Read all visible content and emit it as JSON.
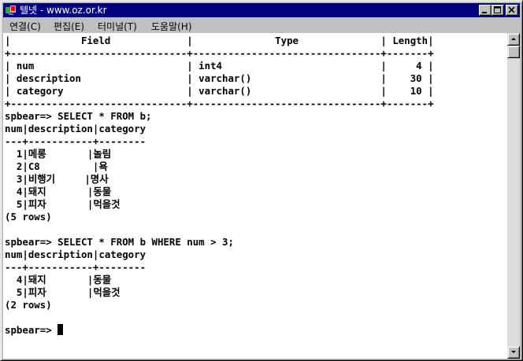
{
  "window": {
    "title": "텔넷 - www.oz.or.kr",
    "icon": "telnet-app-icon",
    "minimize_icon": "minimize-icon",
    "maximize_icon": "maximize-icon",
    "close_icon": "close-icon"
  },
  "menu": {
    "items": [
      {
        "label": "연결(C)"
      },
      {
        "label": "편집(E)"
      },
      {
        "label": "터미널(T)"
      },
      {
        "label": "도움말(H)"
      }
    ]
  },
  "terminal": {
    "lines": [
      "|            Field             |              Type              | Length|",
      "+------------------------------+--------------------------------+-------+",
      "| num                          | int4                           |     4 |",
      "| description                  | varchar()                      |    30 |",
      "| category                     | varchar()                      |    10 |",
      "+------------------------------+--------------------------------+-------+",
      "spbear=> SELECT * FROM b;",
      "num|description|category",
      "---+-----------+--------",
      "  1|메롱       |놀림",
      "  2|C8         |욕",
      "  3|비행기     |명사",
      "  4|돼지       |동물",
      "  5|피자       |먹을것",
      "(5 rows)",
      "",
      "spbear=> SELECT * FROM b WHERE num > 3;",
      "num|description|category",
      "---+-----------+--------",
      "  4|돼지       |동물",
      "  5|피자       |먹을것",
      "(2 rows)",
      "",
      "spbear=> "
    ],
    "cursor": "text-cursor"
  },
  "scrollbar": {
    "up_icon": "scroll-up-arrow-icon",
    "down_icon": "scroll-down-arrow-icon"
  },
  "colors": {
    "titlebar": "#000080",
    "terminal_bg": "#ffffff",
    "terminal_fg": "#000000",
    "chrome": "#c0c0c0"
  }
}
